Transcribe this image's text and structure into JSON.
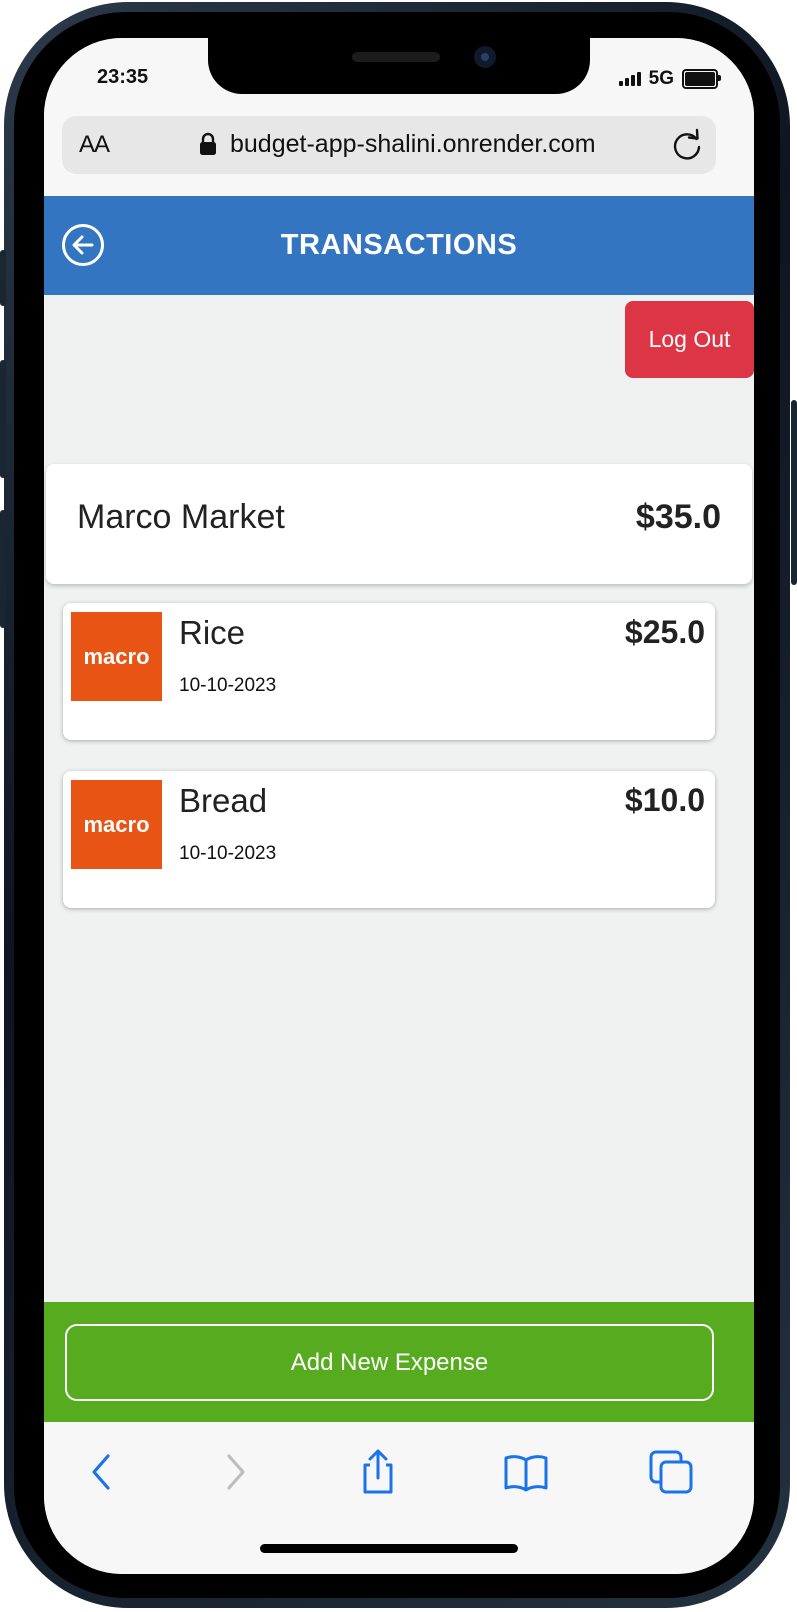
{
  "status_bar": {
    "time": "23:35",
    "network": "5G"
  },
  "browser": {
    "text_size_label": "AA",
    "url": "budget-app-shalini.onrender.com"
  },
  "app": {
    "title": "TRANSACTIONS",
    "logout_label": "Log Out",
    "category": {
      "name": "Marco Market",
      "total": "$35.0"
    },
    "transactions": [
      {
        "name": "Rice",
        "date": "10-10-2023",
        "amount": "$25.0",
        "logo_text": "macro"
      },
      {
        "name": "Bread",
        "date": "10-10-2023",
        "amount": "$10.0",
        "logo_text": "macro"
      }
    ],
    "add_expense_label": "Add New Expense"
  },
  "colors": {
    "header": "#3375c0",
    "logout": "#dc3545",
    "footer": "#56ab1f",
    "logo": "#e85414",
    "toolbar_accent": "#1a73e8"
  },
  "icons": {
    "back": "back-arrow-circle-icon",
    "lock": "lock-icon",
    "reload": "reload-icon",
    "toolbar": [
      "back-chevron-icon",
      "forward-chevron-icon",
      "share-icon",
      "bookmarks-icon",
      "tabs-icon"
    ]
  }
}
